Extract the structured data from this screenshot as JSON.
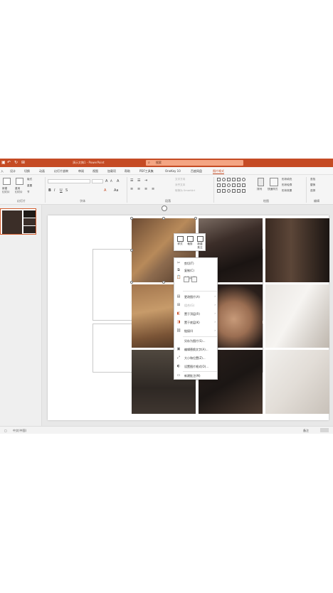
{
  "titlebar": {
    "doc_title": "演示文稿1 - PowerPoint",
    "search_placeholder": "搜索"
  },
  "tabs": [
    {
      "label": "入"
    },
    {
      "label": "设计"
    },
    {
      "label": "切换"
    },
    {
      "label": "动画"
    },
    {
      "label": "幻灯片放映"
    },
    {
      "label": "审阅"
    },
    {
      "label": "视图"
    },
    {
      "label": "加载项"
    },
    {
      "label": "帮助"
    },
    {
      "label": "PDF工具集"
    },
    {
      "label": "OneKey 10"
    },
    {
      "label": "百度网盘"
    },
    {
      "label": "图片格式"
    }
  ],
  "ribbon": {
    "new_slide": "新建\n幻灯片",
    "reuse_slide": "重用\n幻灯片",
    "layout": "版式",
    "reset": "重置",
    "section": "节",
    "slides_group": "幻灯片",
    "font_group": "字体",
    "paragraph_group": "段落",
    "text_direction": "文字方向",
    "align_text": "对齐文本",
    "smartart": "转换为 SmartArt",
    "arrange": "排列",
    "quick_styles": "快速样式",
    "shape_fill": "形状填充",
    "shape_outline": "形状轮廓",
    "shape_effects": "形状效果",
    "drawing_group": "绘图",
    "find": "查找",
    "replace": "替换",
    "select": "选择",
    "editing_group": "编辑"
  },
  "mini_toolbar": [
    {
      "label": "样式"
    },
    {
      "label": "裁剪"
    },
    {
      "label": "新建\n批注"
    }
  ],
  "context_menu": {
    "cut": "剪切(T)",
    "copy": "复制(C)",
    "paste_options": "粘贴选项:",
    "change_picture": "更改图片(A)",
    "group": "组合(G)",
    "bring_to_front": "置于顶层(R)",
    "send_to_back": "置于底层(K)",
    "link": "链接(I)",
    "save_as_picture": "另存为图片(S)...",
    "edit_alt_text": "编辑替换文字(A)...",
    "size_position": "大小和位置(Z)...",
    "format_picture": "设置图片格式(O)...",
    "new_comment": "新建批注(M)"
  },
  "statusbar": {
    "language": "中文(中国)",
    "notes": "备注"
  },
  "colors": {
    "accent": "#c54b24",
    "photo_dark": "#2a211d",
    "photo_warm": "#8a5a3c"
  }
}
